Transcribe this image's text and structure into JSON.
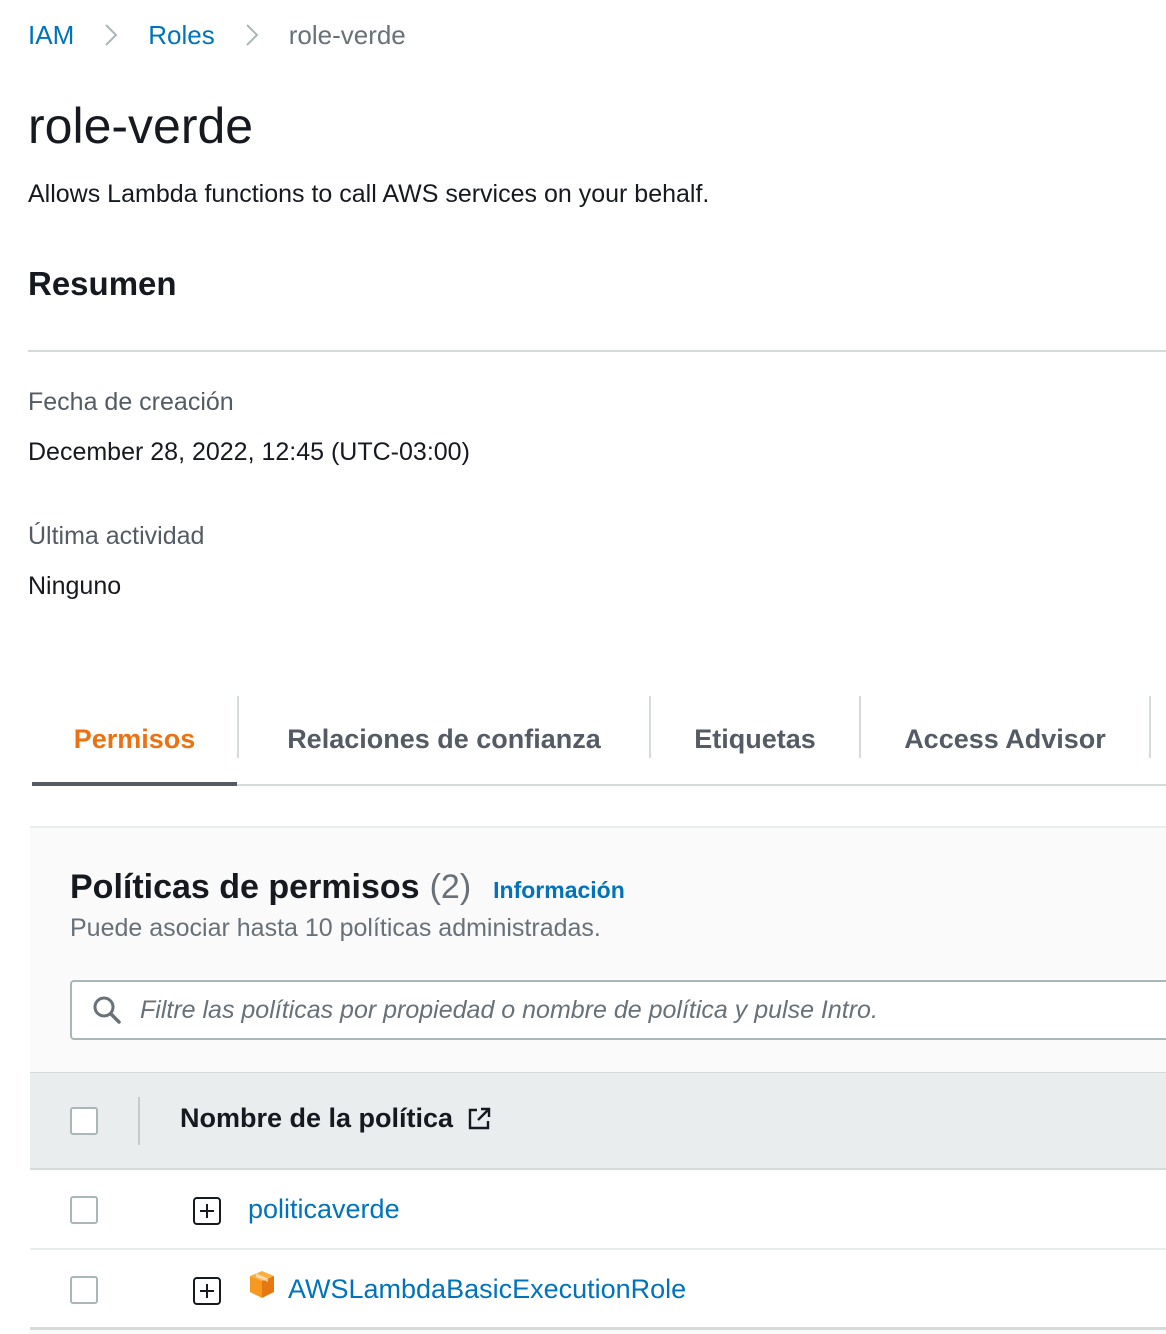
{
  "breadcrumb": {
    "items": [
      {
        "label": "IAM"
      },
      {
        "label": "Roles"
      },
      {
        "label": "role-verde"
      }
    ]
  },
  "role": {
    "title": "role-verde",
    "description": "Allows Lambda functions to call AWS services on your behalf."
  },
  "summary": {
    "title": "Resumen",
    "created_label": "Fecha de creación",
    "created_value": "December 28, 2022, 12:45 (UTC-03:00)",
    "last_activity_label": "Última actividad",
    "last_activity_value": "Ninguno"
  },
  "tabs": [
    {
      "label": "Permisos",
      "active": true
    },
    {
      "label": "Relaciones de confianza",
      "active": false
    },
    {
      "label": "Etiquetas",
      "active": false
    },
    {
      "label": "Access Advisor",
      "active": false
    }
  ],
  "policies": {
    "title": "Políticas de permisos",
    "count": "(2)",
    "info_link": "Información",
    "subtitle": "Puede asociar hasta 10 políticas administradas.",
    "search_placeholder": "Filtre las políticas por propiedad o nombre de política y pulse Intro.",
    "column_header": "Nombre de la política",
    "rows": [
      {
        "name": "politicaverde",
        "aws_managed": false,
        "icon": "plus-square-icon"
      },
      {
        "name": "AWSLambdaBasicExecutionRole",
        "aws_managed": true,
        "icon": "aws-managed-icon"
      }
    ]
  },
  "colors": {
    "link": "#0073bb",
    "active_tab": "#ec7211",
    "aws_icon": "#f7981f"
  }
}
